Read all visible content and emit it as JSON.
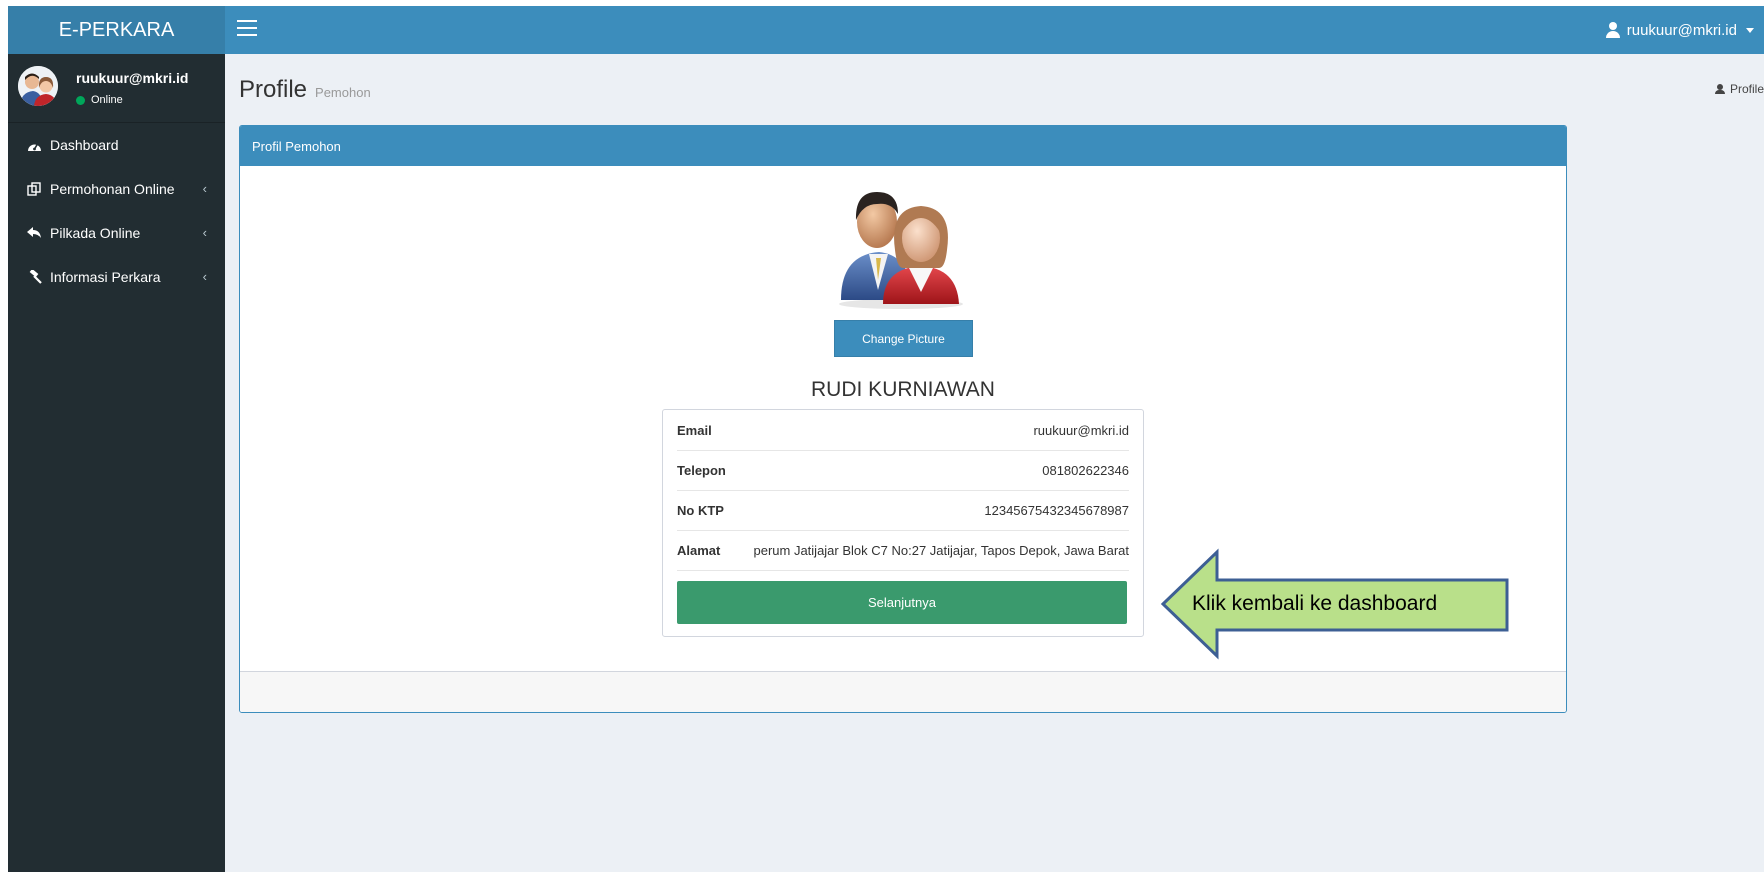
{
  "app": {
    "logo": "E-PERKARA"
  },
  "navbar": {
    "user_email": "ruukuur@mkri.id"
  },
  "sidebar": {
    "user_name": "ruukuur@mkri.id",
    "status": "Online",
    "items": [
      {
        "label": "Dashboard",
        "icon": "dashboard-icon"
      },
      {
        "label": "Permohonan Online",
        "icon": "copy-icon"
      },
      {
        "label": "Pilkada Online",
        "icon": "reply-icon"
      },
      {
        "label": "Informasi Perkara",
        "icon": "gavel-icon"
      }
    ]
  },
  "page": {
    "title": "Profile",
    "subtitle": "Pemohon",
    "breadcrumb": "Profile"
  },
  "profile": {
    "box_title": "Profil Pemohon",
    "change_picture": "Change Picture",
    "name": "RUDI KURNIAWAN",
    "fields": [
      {
        "label": "Email",
        "value": "ruukuur@mkri.id"
      },
      {
        "label": "Telepon",
        "value": "081802622346"
      },
      {
        "label": "No KTP",
        "value": "12345675432345678987"
      },
      {
        "label": "Alamat",
        "value": "perum Jatijajar Blok C7 No:27 Jatijajar, Tapos Depok, Jawa Barat"
      }
    ],
    "next_button": "Selanjutnya"
  },
  "callout": {
    "text": "Klik kembali ke dashboard",
    "fill": "#b9e08a",
    "stroke": "#3d5f94"
  },
  "colors": {
    "primary": "#3c8dbc",
    "success": "#3a9a6d",
    "sidebar": "#222d32"
  }
}
